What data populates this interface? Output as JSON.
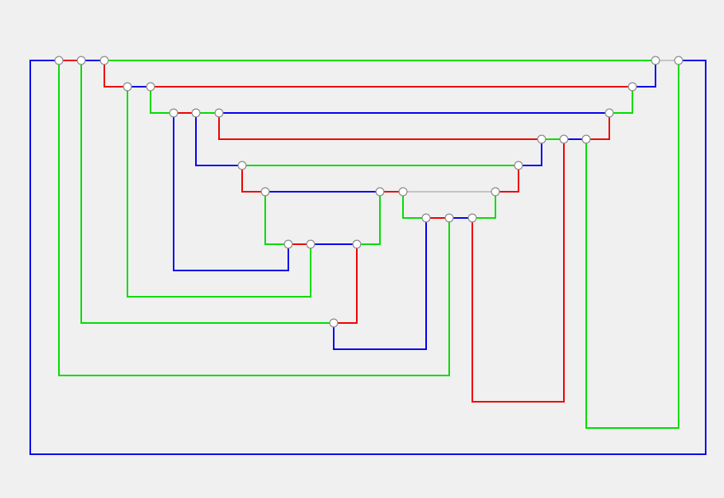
{
  "background": "#f0f0f0",
  "colors": {
    "blue": "#0000ee",
    "red": "#ee0000",
    "green": "#00dd00",
    "gray": "#c4c4c4",
    "node_fill": "#ffffff",
    "node_stroke": "#8a8a8a"
  },
  "diagram": {
    "wire_count": 32,
    "node_count": 29
  }
}
